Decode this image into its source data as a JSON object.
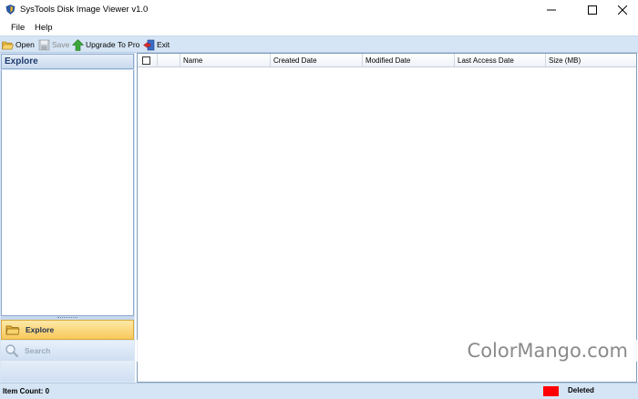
{
  "window": {
    "title": "SysTools Disk Image Viewer v1.0",
    "icon": "shield-app-icon",
    "controls": [
      "minimize-icon",
      "maximize-icon",
      "close-icon"
    ]
  },
  "menu": {
    "items": [
      {
        "label": "File"
      },
      {
        "label": "Help"
      }
    ]
  },
  "toolbar": {
    "open_label": "Open",
    "save_label": "Save",
    "upgrade_label": "Upgrade To Pro",
    "exit_label": "Exit",
    "save_enabled": false
  },
  "left_panel": {
    "header": "Explore",
    "nav": {
      "explore_label": "Explore",
      "search_label": "Search",
      "active": "Explore"
    }
  },
  "grid": {
    "columns": [
      "Name",
      "Created Date",
      "Modified Date",
      "Last Access Date",
      "Size (MB)"
    ],
    "rows": []
  },
  "watermark": {
    "text": "ColorMango.com"
  },
  "status": {
    "item_count": "Item Count: 0",
    "legend_label": "Deleted",
    "legend_color": "#ff0000"
  }
}
